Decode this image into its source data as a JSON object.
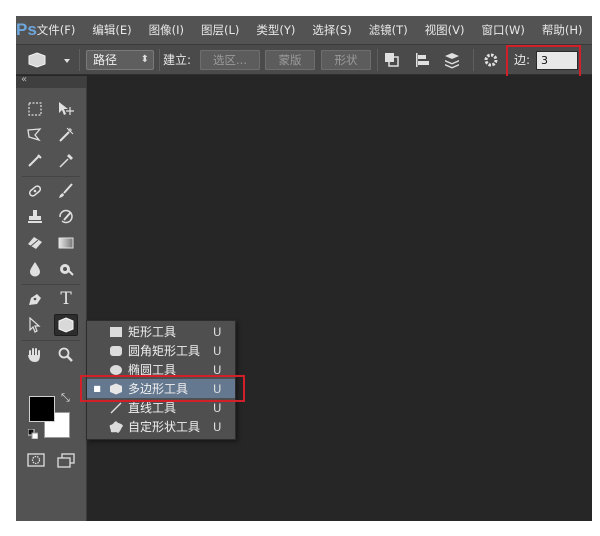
{
  "app": {
    "logo": "Ps"
  },
  "menu": [
    {
      "label": "文件(F)"
    },
    {
      "label": "编辑(E)"
    },
    {
      "label": "图像(I)"
    },
    {
      "label": "图层(L)"
    },
    {
      "label": "类型(Y)"
    },
    {
      "label": "选择(S)"
    },
    {
      "label": "滤镜(T)"
    },
    {
      "label": "视图(V)"
    },
    {
      "label": "窗口(W)"
    },
    {
      "label": "帮助(H)"
    }
  ],
  "options": {
    "mode_select": "路径",
    "make_label": "建立:",
    "selection_button": "选区...",
    "mask_button": "蒙版",
    "shape_button": "形状",
    "sides_label": "边:",
    "sides_value": "3"
  },
  "flyout": {
    "items": [
      {
        "label": "矩形工具",
        "shortcut": "U",
        "icon": "rectangle-icon"
      },
      {
        "label": "圆角矩形工具",
        "shortcut": "U",
        "icon": "rounded-rectangle-icon"
      },
      {
        "label": "椭圆工具",
        "shortcut": "U",
        "icon": "ellipse-icon"
      },
      {
        "label": "多边形工具",
        "shortcut": "U",
        "icon": "polygon-icon",
        "selected": true
      },
      {
        "label": "直线工具",
        "shortcut": "U",
        "icon": "line-icon"
      },
      {
        "label": "自定形状工具",
        "shortcut": "U",
        "icon": "custom-shape-icon"
      }
    ]
  },
  "colors": {
    "foreground": "#000000",
    "background": "#ffffff",
    "highlight_box": "#d2202a",
    "selected_item": "#64788f"
  }
}
